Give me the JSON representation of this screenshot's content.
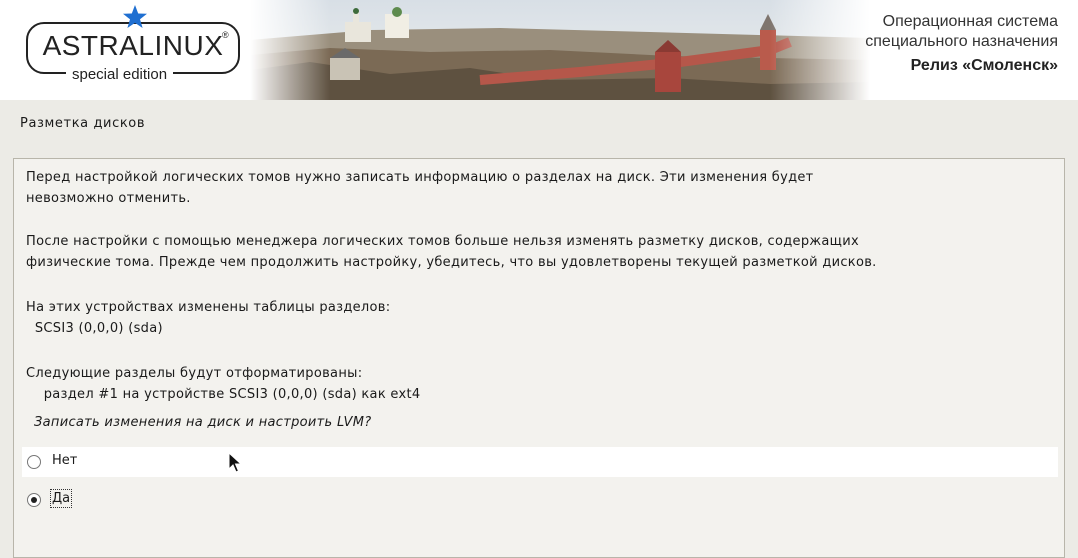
{
  "banner": {
    "logo_name": "ASTRALINUX",
    "logo_reg": "®",
    "logo_sub": "special edition",
    "tagline_line1": "Операционная система",
    "tagline_line2": "специального назначения",
    "tagline_line3": "Релиз «Смоленск»"
  },
  "page_title": "Разметка дисков",
  "body": {
    "p1_line1": "Перед настройкой логических томов нужно записать информацию о разделах на диск. Эти изменения будет",
    "p1_line2": "невозможно отменить.",
    "p2_line1": "После настройки с помощью менеджера логических томов больше нельзя изменять разметку дисков, содержащих",
    "p2_line2": "физические тома. Прежде чем продолжить настройку, убедитесь, что вы удовлетворены текущей разметкой дисков.",
    "p3_line1": "На этих устройствах изменены таблицы разделов:",
    "p3_line2": "  SCSI3 (0,0,0) (sda)",
    "p4_line1": "Следующие разделы будут отформатированы:",
    "p4_line2": "    раздел #1 на устройстве SCSI3 (0,0,0) (sda) как ext4",
    "question": "Записать изменения на диск и настроить LVM?"
  },
  "options": [
    {
      "label": "Нет",
      "selected": false
    },
    {
      "label": "Да",
      "selected": true
    }
  ],
  "colors": {
    "background": "#ecebe6",
    "content_bg": "#f3f2ee",
    "highlight_row": "#ffffff",
    "logo_star": "#1f6fd1"
  },
  "icons": {
    "logo_star": "star-icon",
    "cursor": "mouse-pointer-icon",
    "radio": "radio-button-icon"
  }
}
